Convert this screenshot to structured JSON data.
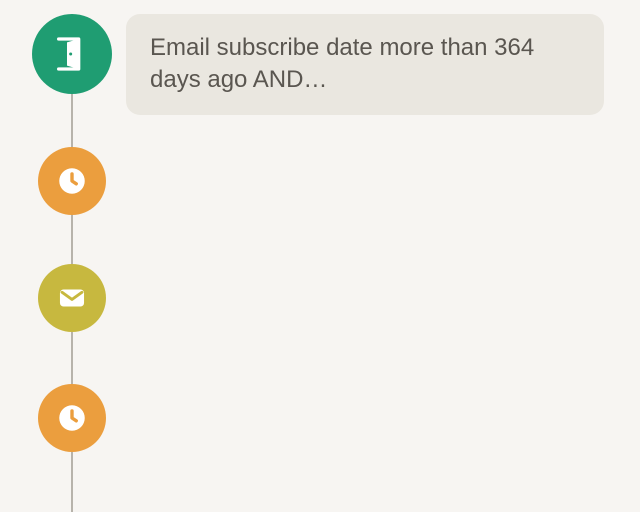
{
  "colors": {
    "bg": "#f7f5f2",
    "card_bg": "#eae7e0",
    "text": "#5a5650",
    "connector": "#b7b3ab",
    "node_green": "#1f9d72",
    "node_orange": "#eb9e3e",
    "node_olive": "#c7b83f",
    "icon_white": "#ffffff"
  },
  "flow": {
    "start_card_text": "Email subscribe date more than 364 days ago AND…",
    "nodes": [
      {
        "type": "door",
        "label": "start-trigger"
      },
      {
        "type": "clock",
        "label": "wait-step-1"
      },
      {
        "type": "mail",
        "label": "email-step"
      },
      {
        "type": "clock",
        "label": "wait-step-2"
      }
    ]
  }
}
